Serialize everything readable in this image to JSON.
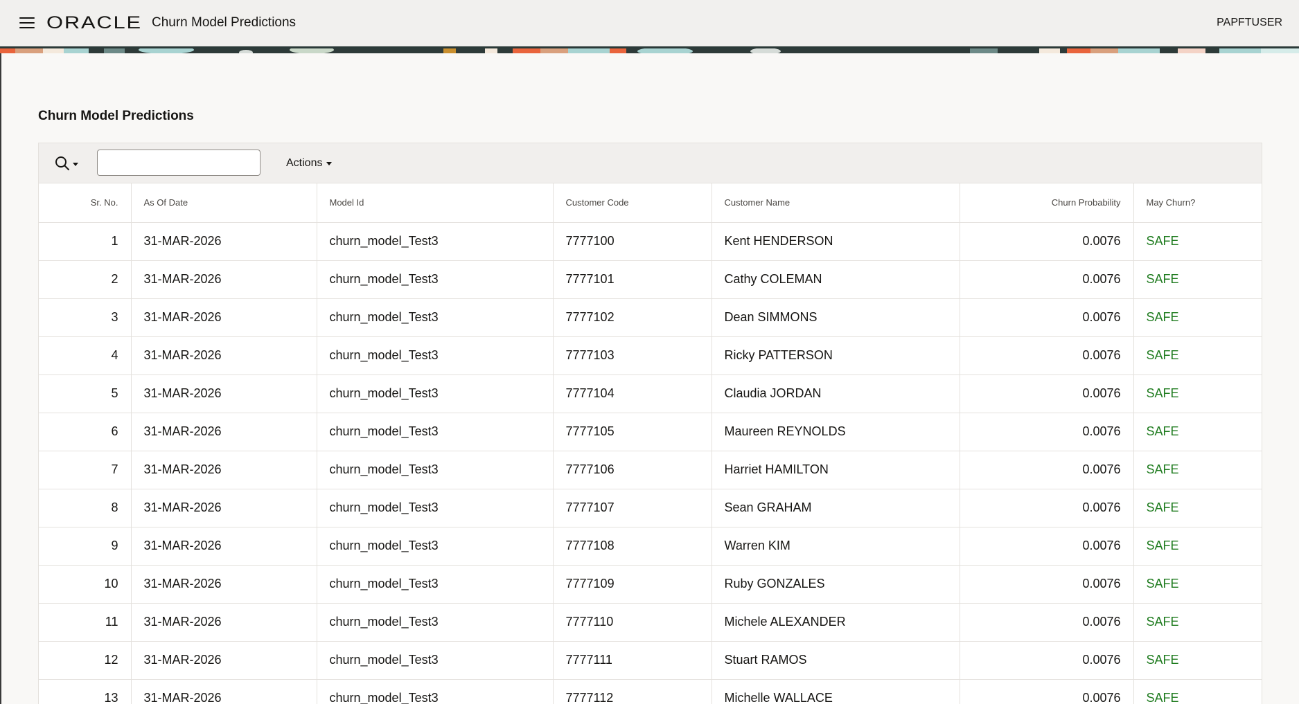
{
  "header": {
    "brand": "ORACLE",
    "app_title": "Churn Model Predictions",
    "username": "PAPFTUSER"
  },
  "page": {
    "title": "Churn Model Predictions"
  },
  "toolbar": {
    "search_value": "",
    "actions_label": "Actions"
  },
  "table": {
    "columns": [
      "Sr. No.",
      "As Of Date",
      "Model Id",
      "Customer Code",
      "Customer Name",
      "Churn Probability",
      "May Churn?"
    ],
    "rows": [
      [
        "1",
        "31-MAR-2026",
        "churn_model_Test3",
        "7777100",
        "Kent HENDERSON",
        "0.0076",
        "SAFE"
      ],
      [
        "2",
        "31-MAR-2026",
        "churn_model_Test3",
        "7777101",
        "Cathy COLEMAN",
        "0.0076",
        "SAFE"
      ],
      [
        "3",
        "31-MAR-2026",
        "churn_model_Test3",
        "7777102",
        "Dean SIMMONS",
        "0.0076",
        "SAFE"
      ],
      [
        "4",
        "31-MAR-2026",
        "churn_model_Test3",
        "7777103",
        "Ricky PATTERSON",
        "0.0076",
        "SAFE"
      ],
      [
        "5",
        "31-MAR-2026",
        "churn_model_Test3",
        "7777104",
        "Claudia JORDAN",
        "0.0076",
        "SAFE"
      ],
      [
        "6",
        "31-MAR-2026",
        "churn_model_Test3",
        "7777105",
        "Maureen REYNOLDS",
        "0.0076",
        "SAFE"
      ],
      [
        "7",
        "31-MAR-2026",
        "churn_model_Test3",
        "7777106",
        "Harriet HAMILTON",
        "0.0076",
        "SAFE"
      ],
      [
        "8",
        "31-MAR-2026",
        "churn_model_Test3",
        "7777107",
        "Sean GRAHAM",
        "0.0076",
        "SAFE"
      ],
      [
        "9",
        "31-MAR-2026",
        "churn_model_Test3",
        "7777108",
        "Warren KIM",
        "0.0076",
        "SAFE"
      ],
      [
        "10",
        "31-MAR-2026",
        "churn_model_Test3",
        "7777109",
        "Ruby GONZALES",
        "0.0076",
        "SAFE"
      ],
      [
        "11",
        "31-MAR-2026",
        "churn_model_Test3",
        "7777110",
        "Michele ALEXANDER",
        "0.0076",
        "SAFE"
      ],
      [
        "12",
        "31-MAR-2026",
        "churn_model_Test3",
        "7777111",
        "Stuart RAMOS",
        "0.0076",
        "SAFE"
      ],
      [
        "13",
        "31-MAR-2026",
        "churn_model_Test3",
        "7777112",
        "Michelle WALLACE",
        "0.0076",
        "SAFE"
      ]
    ]
  },
  "colors": {
    "safe": "#1e7b1e",
    "header_bg": "#f1f0ee",
    "page_bg": "#f9f8f6"
  },
  "icons": {
    "menu": "hamburger-icon",
    "search": "search-icon",
    "dropdown": "chevron-down-icon"
  }
}
